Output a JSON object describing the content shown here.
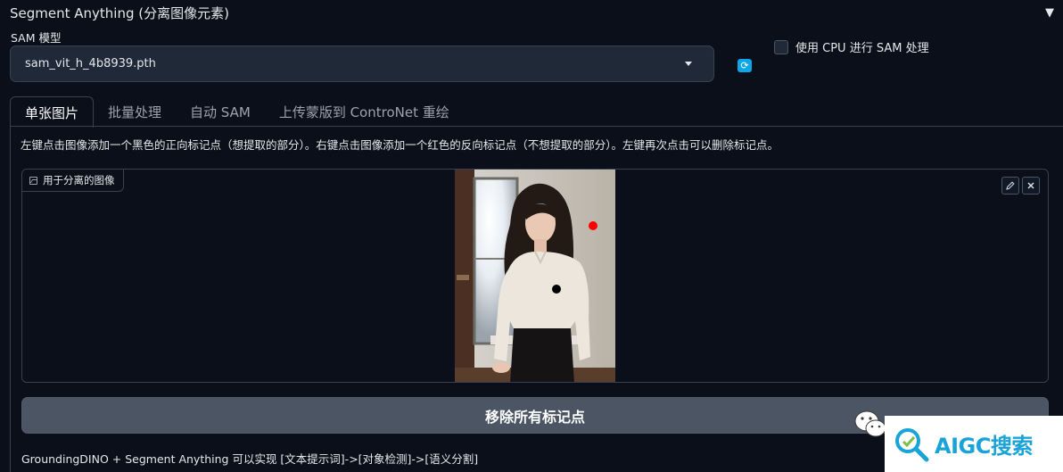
{
  "accordion": {
    "title": "Segment Anything (分离图像元素)"
  },
  "model": {
    "label": "SAM 模型",
    "selected": "sam_vit_h_4b8939.pth",
    "cpu_label": "使用 CPU 进行 SAM 处理"
  },
  "tabs": [
    {
      "label": "单张图片",
      "active": true
    },
    {
      "label": "批量处理",
      "active": false
    },
    {
      "label": "自动 SAM",
      "active": false
    },
    {
      "label": "上传蒙版到 ControNet 重绘",
      "active": false
    }
  ],
  "instructions": "左键点击图像添加一个黑色的正向标记点（想提取的部分）。右键点击图像添加一个红色的反向标记点（不想提取的部分）。左键再次点击可以删除标记点。",
  "image_input": {
    "label": "用于分离的图像"
  },
  "clear_button": "移除所有标记点",
  "footer": "GroundingDINO + Segment Anything 可以实现 [文本提示词]->[对象检测]->[语义分割]",
  "watermark": {
    "text": "AIGC搜索"
  },
  "icons": {
    "caret": "caret-down-icon",
    "refresh": "refresh-icon",
    "image": "image-icon",
    "edit": "pencil-icon",
    "close": "close-icon",
    "wechat": "wechat-icon",
    "search": "search-icon"
  },
  "colors": {
    "background": "#0b0f19",
    "refresh": "#0ea5e9",
    "positive_point": "#000000",
    "negative_point": "#ff0000",
    "watermark": "#1aa3d8"
  }
}
